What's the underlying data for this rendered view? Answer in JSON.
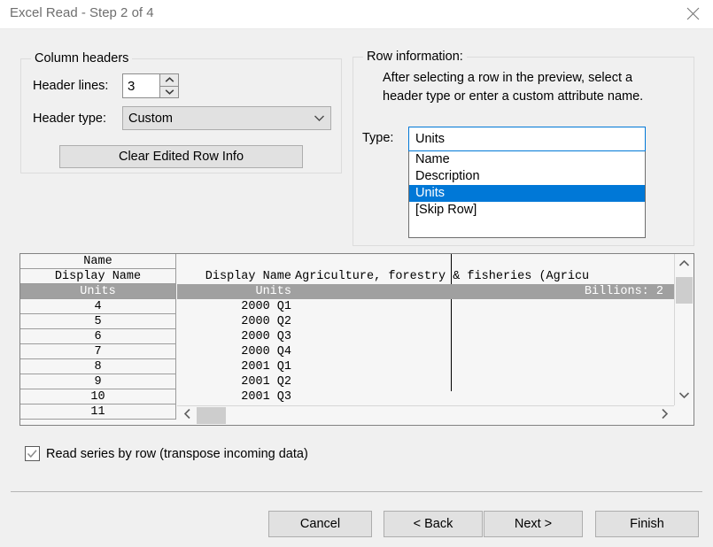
{
  "window": {
    "title": "Excel Read - Step 2 of 4",
    "close_icon": "close-icon"
  },
  "column_headers_group": {
    "title": "Column headers",
    "header_lines_label": "Header lines:",
    "header_lines_value": "3",
    "spinner_up_icon": "chevron-up-icon",
    "spinner_down_icon": "chevron-down-icon",
    "header_type_label": "Header type:",
    "header_type_value": "Custom",
    "header_type_arrow_icon": "chevron-down-icon",
    "clear_button_label": "Clear Edited Row Info"
  },
  "row_information_group": {
    "title": "Row information:",
    "description": "After selecting a row in the preview, select a header type or enter a custom attribute name.",
    "type_label": "Type:",
    "type_value": "Units",
    "type_options": [
      {
        "label": "Name",
        "selected": false
      },
      {
        "label": "Description",
        "selected": false
      },
      {
        "label": "Units",
        "selected": true
      },
      {
        "label": "[Skip Row]",
        "selected": false
      }
    ]
  },
  "preview_grid": {
    "row_headers": [
      {
        "label": "Name",
        "selected": false
      },
      {
        "label": "Display Name",
        "selected": false
      },
      {
        "label": "Units",
        "selected": true
      },
      {
        "label": "4",
        "selected": false
      },
      {
        "label": "5",
        "selected": false
      },
      {
        "label": "6",
        "selected": false
      },
      {
        "label": "7",
        "selected": false
      },
      {
        "label": "8",
        "selected": false
      },
      {
        "label": "9",
        "selected": false
      },
      {
        "label": "10",
        "selected": false
      },
      {
        "label": "11",
        "selected": false
      }
    ],
    "rows": [
      {
        "col1": "",
        "col2": "",
        "col2_align": "left",
        "selected": false
      },
      {
        "col1": "Display Name",
        "col2": "Agriculture, forestry & fisheries (Agricu",
        "col2_align": "left",
        "selected": false
      },
      {
        "col1": "Units",
        "col2": "Billions: 2",
        "col2_align": "right",
        "selected": true
      },
      {
        "col1": "2000 Q1",
        "col2": "",
        "col2_align": "left",
        "selected": false
      },
      {
        "col1": "2000 Q2",
        "col2": "",
        "col2_align": "left",
        "selected": false
      },
      {
        "col1": "2000 Q3",
        "col2": "",
        "col2_align": "left",
        "selected": false
      },
      {
        "col1": "2000 Q4",
        "col2": "",
        "col2_align": "left",
        "selected": false
      },
      {
        "col1": "2001 Q1",
        "col2": "",
        "col2_align": "left",
        "selected": false
      },
      {
        "col1": "2001 Q2",
        "col2": "",
        "col2_align": "left",
        "selected": false
      },
      {
        "col1": "2001 Q3",
        "col2": "",
        "col2_align": "left",
        "selected": false
      }
    ],
    "vscroll_up_icon": "chevron-up-icon",
    "vscroll_down_icon": "chevron-down-icon",
    "hscroll_left_icon": "chevron-left-icon",
    "hscroll_right_icon": "chevron-right-icon"
  },
  "options": {
    "read_series_by_row_label": "Read series by row (transpose incoming data)",
    "read_series_by_row_checked": true,
    "check_icon": "check-icon"
  },
  "footer": {
    "cancel_label": "Cancel",
    "back_label": "< Back",
    "next_label": "Next >",
    "finish_label": "Finish"
  },
  "colors": {
    "dialog_bg": "#f0f0f0",
    "titlebar_bg": "#ffffff",
    "title_text": "#6e6e6e",
    "selection_blue": "#0078d7",
    "grid_selection_gray": "#a0a0a0",
    "button_face": "#e1e1e1"
  }
}
